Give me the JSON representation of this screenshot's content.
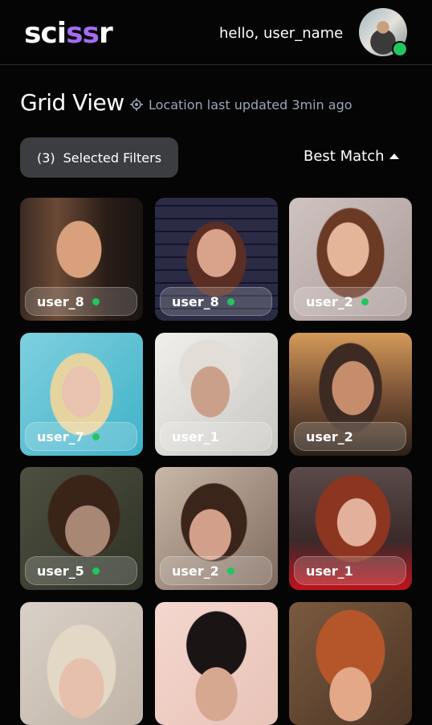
{
  "header": {
    "logo_left": "sci",
    "logo_mid": "ss",
    "logo_right": "r",
    "greeting": "hello, user_name",
    "avatar_status": "online"
  },
  "main": {
    "title": "Grid View",
    "location_icon": "location-target-icon",
    "location_text": "Location last updated 3min ago",
    "filters": {
      "count": "(3)",
      "label": "Selected Filters"
    },
    "sort": {
      "label": "Best Match",
      "icon": "caret-up-icon"
    }
  },
  "profiles": [
    {
      "name": "user_8",
      "online": true
    },
    {
      "name": "user_8",
      "online": true
    },
    {
      "name": "user_2",
      "online": true
    },
    {
      "name": "user_7",
      "online": true
    },
    {
      "name": "user_1",
      "online": false
    },
    {
      "name": "user_2",
      "online": false
    },
    {
      "name": "user_5",
      "online": true
    },
    {
      "name": "user_2",
      "online": true
    },
    {
      "name": "user_1",
      "online": false
    },
    {
      "name": "",
      "online": false
    },
    {
      "name": "",
      "online": false
    },
    {
      "name": "",
      "online": false
    }
  ],
  "colors": {
    "accent": "#a56bf0",
    "online": "#22c55e",
    "filter_bg": "#3b3d41",
    "muted_text": "#9aa6b8"
  }
}
